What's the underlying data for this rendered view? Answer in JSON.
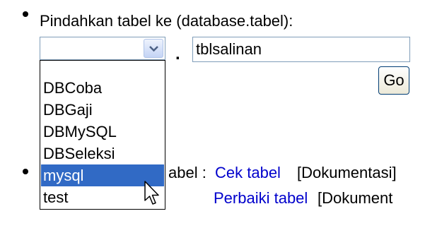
{
  "move_table": {
    "label": "Pindahkan tabel ke (database.tabel):",
    "separator": ".",
    "table_input_value": "tblsalinan",
    "go_button_label": "Go"
  },
  "database_dropdown": {
    "selected_value": "",
    "options": [
      "",
      "DBCoba",
      "DBGaji",
      "DBMySQL",
      "DBSeleksi",
      "mysql",
      "test"
    ],
    "highlighted_option": "mysql"
  },
  "maintenance": {
    "label_partial": "abel :",
    "check_link": "Cek tabel",
    "check_doc_link": "[Dokumentasi]",
    "repair_link": "Perbaiki tabel",
    "repair_doc_link": "[Dokument"
  },
  "colors": {
    "link": "#0000cc",
    "selection": "#316ac5"
  },
  "icons": {
    "dropdown_arrow": "chevron-down-icon",
    "cursor": "mouse-pointer-icon"
  }
}
